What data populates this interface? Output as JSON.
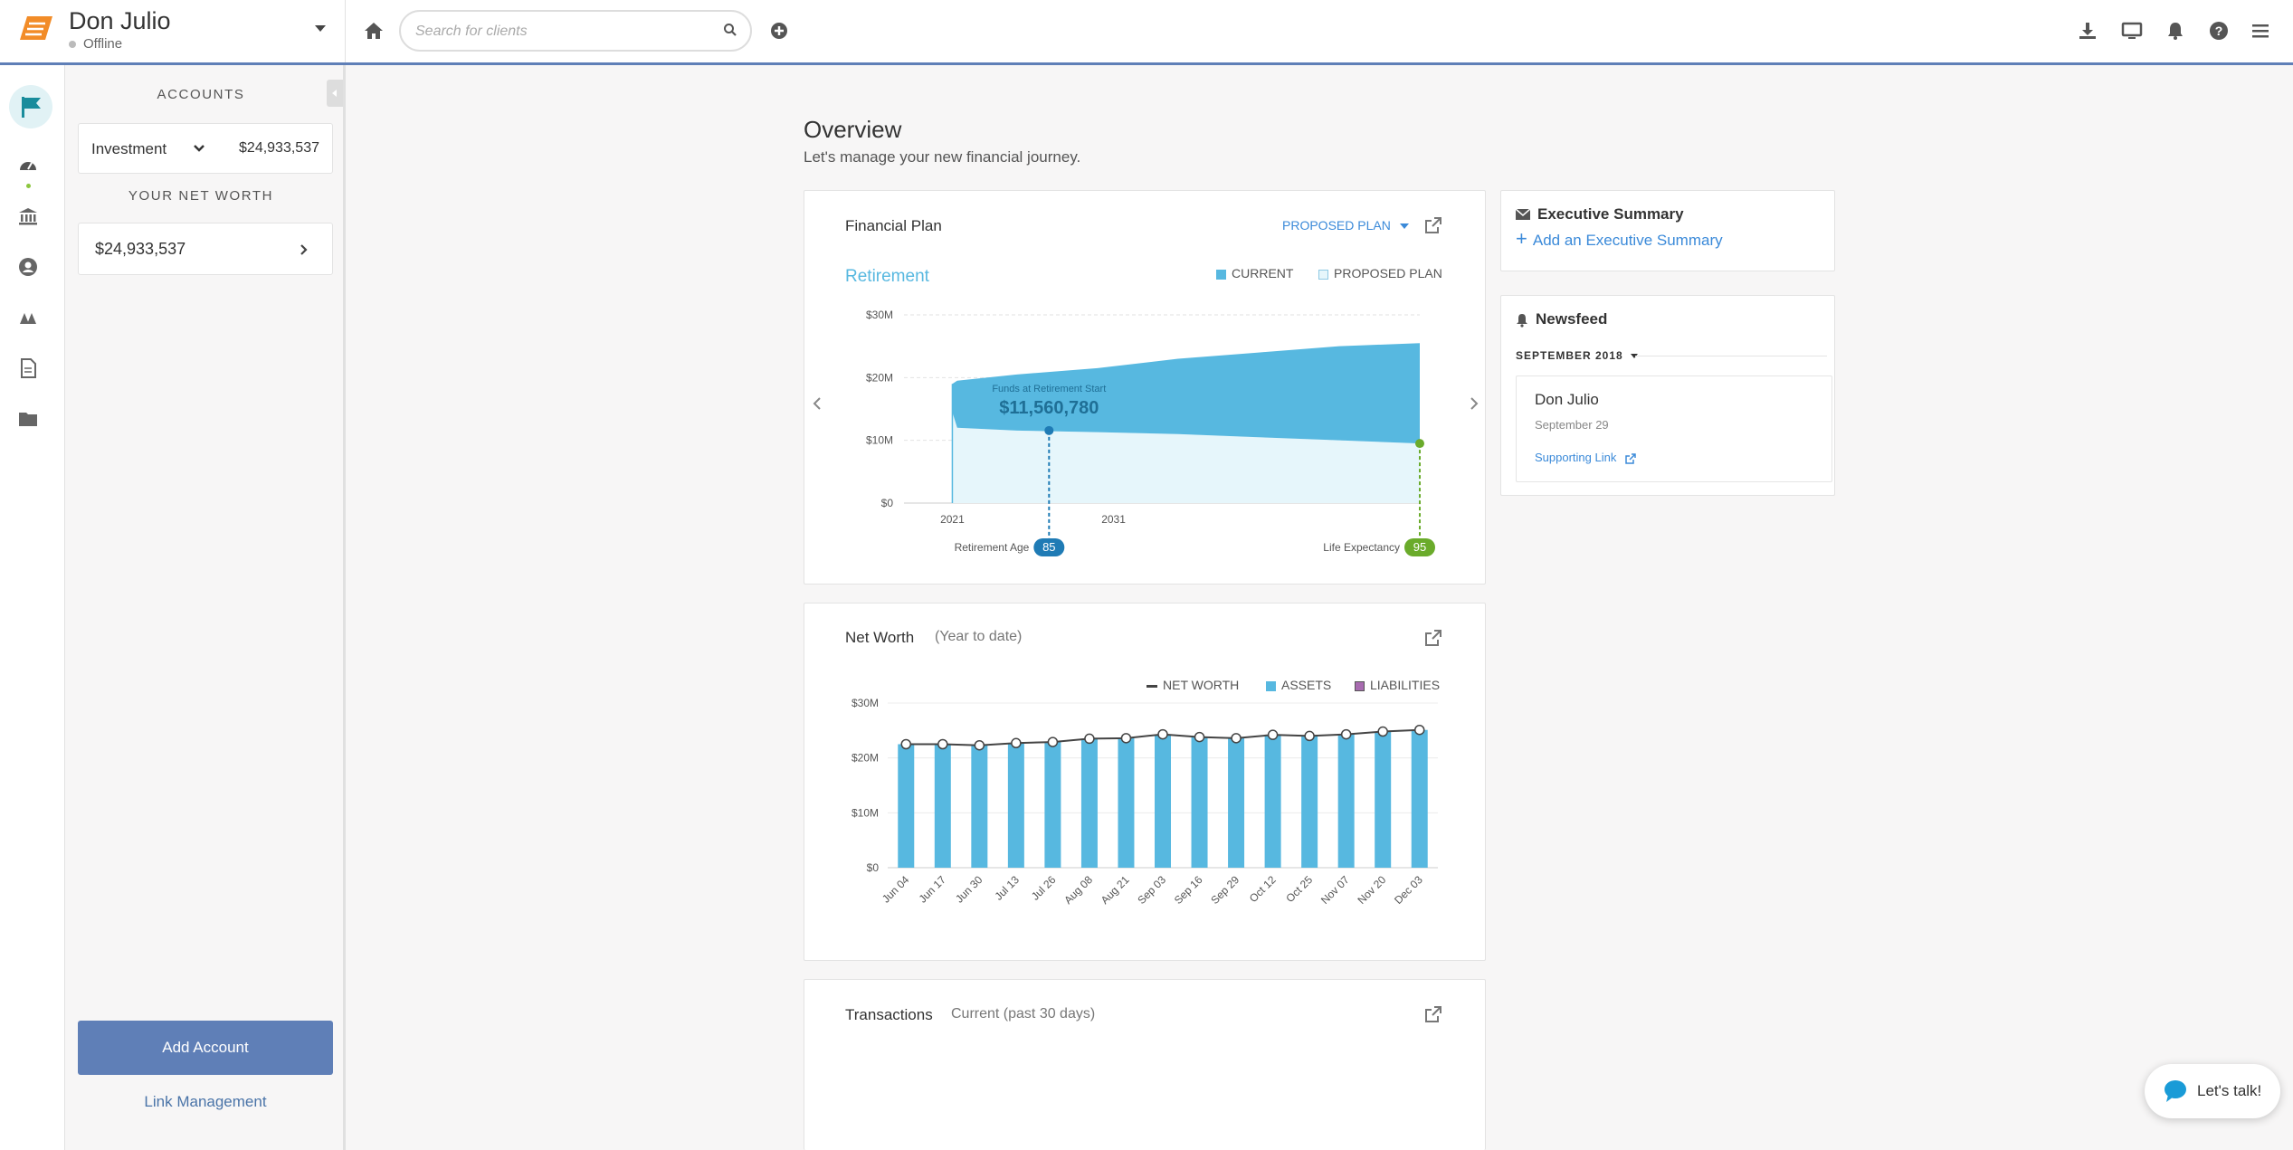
{
  "client": {
    "name": "Don Julio",
    "status": "Offline"
  },
  "search": {
    "placeholder": "Search for clients"
  },
  "accounts_panel": {
    "heading": "ACCOUNTS",
    "account_type": "Investment",
    "account_value": "$24,933,537",
    "net_worth_heading": "YOUR NET WORTH",
    "net_worth_value": "$24,933,537",
    "add_account_label": "Add Account",
    "link_management_label": "Link Management"
  },
  "overview": {
    "title": "Overview",
    "subtitle": "Let's manage your new financial journey."
  },
  "financial_plan": {
    "title": "Financial Plan",
    "plan_selector": "PROPOSED PLAN",
    "section_title": "Retirement",
    "legend_current": "CURRENT",
    "legend_proposed": "PROPOSED PLAN",
    "funds_label": "Funds at Retirement Start",
    "funds_value": "$11,560,780",
    "retirement_age_label": "Retirement Age",
    "retirement_age": "85",
    "life_expectancy_label": "Life Expectancy",
    "life_expectancy": "95"
  },
  "net_worth_card": {
    "title": "Net Worth",
    "subtitle": "(Year to date)",
    "legend_net_worth": "NET WORTH",
    "legend_assets": "ASSETS",
    "legend_liabilities": "LIABILITIES"
  },
  "transactions_card": {
    "title": "Transactions",
    "subtitle": "Current (past 30 days)"
  },
  "executive_summary": {
    "title": "Executive Summary",
    "add_label": "Add an Executive Summary"
  },
  "newsfeed": {
    "title": "Newsfeed",
    "month": "SEPTEMBER 2018",
    "item_name": "Don Julio",
    "item_date": "September 29",
    "item_link": "Supporting Link"
  },
  "chat": {
    "label": "Let's talk!"
  },
  "colors": {
    "accent": "#5f7fb7",
    "current_area": "#57b8e0",
    "proposed_area": "#e6f6fb",
    "link": "#3b8ad9",
    "life_expectancy": "#6aab2b",
    "retirement_age": "#1f7bb5"
  },
  "chart_data": [
    {
      "type": "area",
      "title": "Retirement",
      "x_tick_labels": [
        "2021",
        "2031"
      ],
      "y_tick_labels": [
        "$0",
        "$10M",
        "$20M",
        "$30M"
      ],
      "ylim": [
        0,
        30000000
      ],
      "xlim": [
        2018,
        2050
      ],
      "series": [
        {
          "name": "CURRENT",
          "x": [
            2021,
            2021.3,
            2025,
            2030,
            2035,
            2040,
            2045,
            2050
          ],
          "upper": [
            19000000,
            19500000,
            20500000,
            21500000,
            23000000,
            24000000,
            25000000,
            25500000
          ],
          "lower": [
            14500000,
            12000000,
            11560780,
            11300000,
            11000000,
            10500000,
            10000000,
            9500000
          ]
        },
        {
          "name": "PROPOSED PLAN",
          "x": [
            2021,
            2021.3,
            2025,
            2030,
            2035,
            2040,
            2045,
            2050
          ],
          "values": [
            14500000,
            12000000,
            11560780,
            11300000,
            11000000,
            10500000,
            10000000,
            9500000
          ]
        }
      ],
      "markers": [
        {
          "label": "Retirement Age",
          "age": "85",
          "x": 2027,
          "y": 11560780
        },
        {
          "label": "Life Expectancy",
          "age": "95",
          "x": 2050,
          "y": 9500000
        }
      ]
    },
    {
      "type": "bar",
      "title": "Net Worth",
      "categories": [
        "Jun 04",
        "Jun 17",
        "Jun 30",
        "Jul 13",
        "Jul 26",
        "Aug 08",
        "Aug 21",
        "Sep 03",
        "Sep 16",
        "Sep 29",
        "Oct 12",
        "Oct 25",
        "Nov 07",
        "Nov 20",
        "Dec 03"
      ],
      "y_tick_labels": [
        "$0",
        "$10M",
        "$20M",
        "$30M"
      ],
      "ylim": [
        0,
        30000000
      ],
      "series": [
        {
          "name": "ASSETS",
          "values": [
            22500000,
            22500000,
            22300000,
            22700000,
            22900000,
            23500000,
            23600000,
            24300000,
            23800000,
            23600000,
            24200000,
            24000000,
            24300000,
            24800000,
            25100000
          ]
        },
        {
          "name": "NET WORTH",
          "values": [
            22500000,
            22500000,
            22300000,
            22700000,
            22900000,
            23500000,
            23600000,
            24300000,
            23800000,
            23600000,
            24200000,
            24000000,
            24300000,
            24800000,
            25100000
          ]
        },
        {
          "name": "LIABILITIES",
          "values": [
            0,
            0,
            0,
            0,
            0,
            0,
            0,
            0,
            0,
            0,
            0,
            0,
            0,
            0,
            0
          ]
        }
      ]
    }
  ]
}
